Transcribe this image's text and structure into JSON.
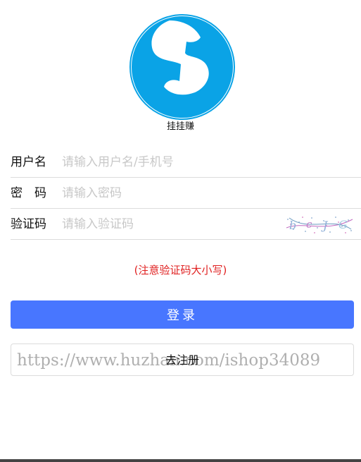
{
  "app": {
    "name": "挂挂赚",
    "brand_color": "#0aa3e6"
  },
  "form": {
    "username": {
      "label": "用户名",
      "placeholder": "请输入用户名/手机号",
      "value": ""
    },
    "password": {
      "label": "密　码",
      "placeholder": "请输入密码",
      "value": ""
    },
    "captcha": {
      "label": "验证码",
      "placeholder": "请输入验证码",
      "value": "",
      "image_text": "bcJG"
    }
  },
  "notice": {
    "text": "(注意验证码大小写)",
    "color": "#e02020"
  },
  "buttons": {
    "login_label": "登录",
    "login_color": "#4876ff",
    "register_label": "去注册"
  },
  "watermark": {
    "text": "https://www.huzhan.com/ishop34089"
  }
}
